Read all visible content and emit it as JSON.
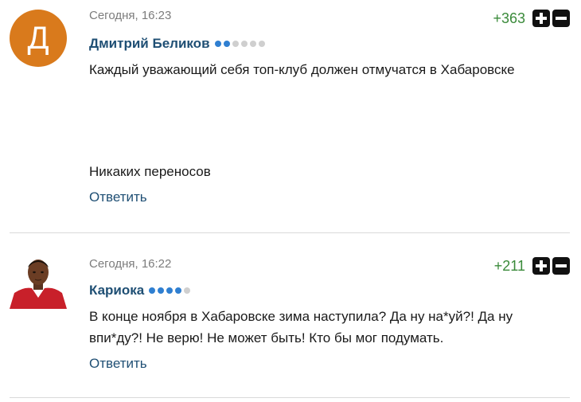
{
  "comments": [
    {
      "avatar_letter": "Д",
      "timestamp": "Сегодня, 16:23",
      "author": "Дмитрий Беликов",
      "rank_dots_filled": 2,
      "rank_dots_total": 6,
      "score": "+363",
      "text_lines": [
        "Каждый уважающий себя топ-клуб должен отмучатся в Хабаровске",
        "Никаких переносов"
      ],
      "reply_label": "Ответить"
    },
    {
      "avatar": "user-photo",
      "timestamp": "Сегодня, 16:22",
      "author": "Кариока",
      "rank_dots_filled": 4,
      "rank_dots_total": 5,
      "score": "+211",
      "text_lines": [
        "В конце ноября в Хабаровске зима наступила? Да ну на*уй?! Да ну впи*ду?! Не верю! Не может быть! Кто бы мог подумать."
      ],
      "reply_label": "Ответить"
    }
  ],
  "colors": {
    "author": "#1f4f74",
    "score": "#3a8a3a",
    "rank_on": "#2f7fd1",
    "rank_off": "#cfcfcf",
    "avatar_bg": "#d97a1c"
  }
}
